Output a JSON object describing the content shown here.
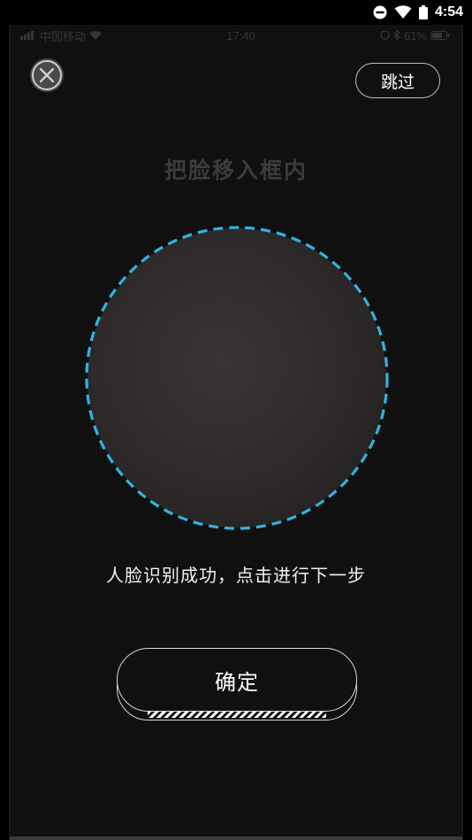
{
  "system_status": {
    "time": "4:54",
    "icons": [
      "do-not-disturb-icon",
      "wifi-icon",
      "battery-icon"
    ]
  },
  "ios_status": {
    "carrier": "中国移动",
    "time": "17:40",
    "battery": "61%"
  },
  "header": {
    "close_icon": "close-icon",
    "skip_label": "跳过"
  },
  "main": {
    "instruction": "把脸移入框内",
    "frame_color": "#2fb4e0",
    "status_text": "人脸识别成功，点击进行下一步",
    "confirm_label": "确定"
  }
}
